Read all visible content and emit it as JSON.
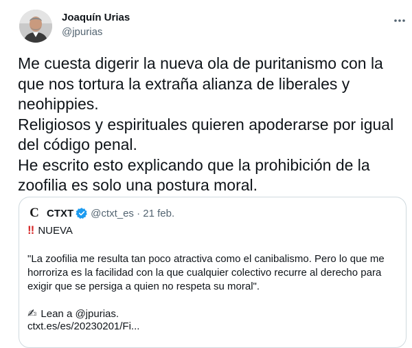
{
  "author": {
    "name": "Joaquín Urias",
    "handle": "@jpurias"
  },
  "tweet_lines": [
    "Me cuesta digerir la nueva ola de puritanismo con la",
    "que nos tortura la extraña alianza de liberales y",
    "neohippies.",
    "Religiosos y espirituales quieren apoderarse por igual",
    "del código penal.",
    "He escrito esto explicando que  la prohibición de la",
    "zoofilia es solo una postura moral."
  ],
  "quote": {
    "logo": "C",
    "name": "CTXT",
    "handle_date": "@ctxt_es · 21 feb.",
    "badge_marks": "!!",
    "badge_text": "NUEVA",
    "body_lines": [
      "\"La zoofilia me resulta tan poco atractiva como el canibalismo. Pero lo que me",
      "horroriza es la facilidad con la que cualquier colectivo recurre al derecho para",
      "exigir que se persiga a quien no respeta su moral\"."
    ],
    "cta_emoji": "✍",
    "cta_text": "Lean a @jpurias.",
    "link": "ctxt.es/es/20230201/Fi..."
  },
  "colors": {
    "text": "#0f1419",
    "secondary": "#536471",
    "border": "#cfd9de",
    "verified": "#1d9bf0",
    "badge": "#d62828"
  },
  "icons": {
    "more": "more-horizontal-icon",
    "verified": "verified-badge-icon"
  }
}
